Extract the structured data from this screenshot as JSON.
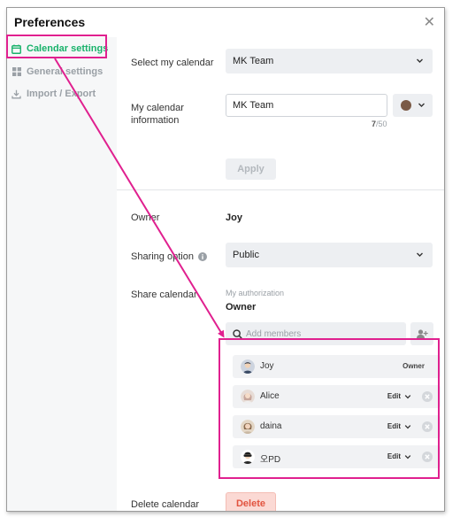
{
  "dialog": {
    "title": "Preferences"
  },
  "sidebar": {
    "items": [
      {
        "label": "Calendar settings",
        "icon": "calendar-icon",
        "active": true
      },
      {
        "label": "General settings",
        "icon": "grid-icon",
        "active": false
      },
      {
        "label": "Import / Export",
        "icon": "download-icon",
        "active": false
      }
    ]
  },
  "calendar": {
    "select_label": "Select my calendar",
    "selected_calendar": "MK Team",
    "info_label": "My calendar information",
    "name_value": "MK Team",
    "char_count": "7",
    "char_limit": "/50",
    "color": "#7a5a46",
    "apply_label": "Apply"
  },
  "owner": {
    "label": "Owner",
    "value": "Joy"
  },
  "sharing": {
    "label": "Sharing option",
    "value": "Public"
  },
  "share": {
    "label": "Share calendar",
    "my_auth_label": "My authorization",
    "my_auth_value": "Owner",
    "add_placeholder": "Add members"
  },
  "members": [
    {
      "name": "Joy",
      "permission": "Owner",
      "removable": false
    },
    {
      "name": "Alice",
      "permission": "Edit",
      "removable": true
    },
    {
      "name": "daina",
      "permission": "Edit",
      "removable": true
    },
    {
      "name": "오PD",
      "permission": "Edit",
      "removable": true
    }
  ],
  "delete": {
    "label": "Delete calendar",
    "button": "Delete"
  },
  "colors": {
    "accent": "#19b26b",
    "highlight": "#e0208f",
    "danger": "#e2533f"
  }
}
